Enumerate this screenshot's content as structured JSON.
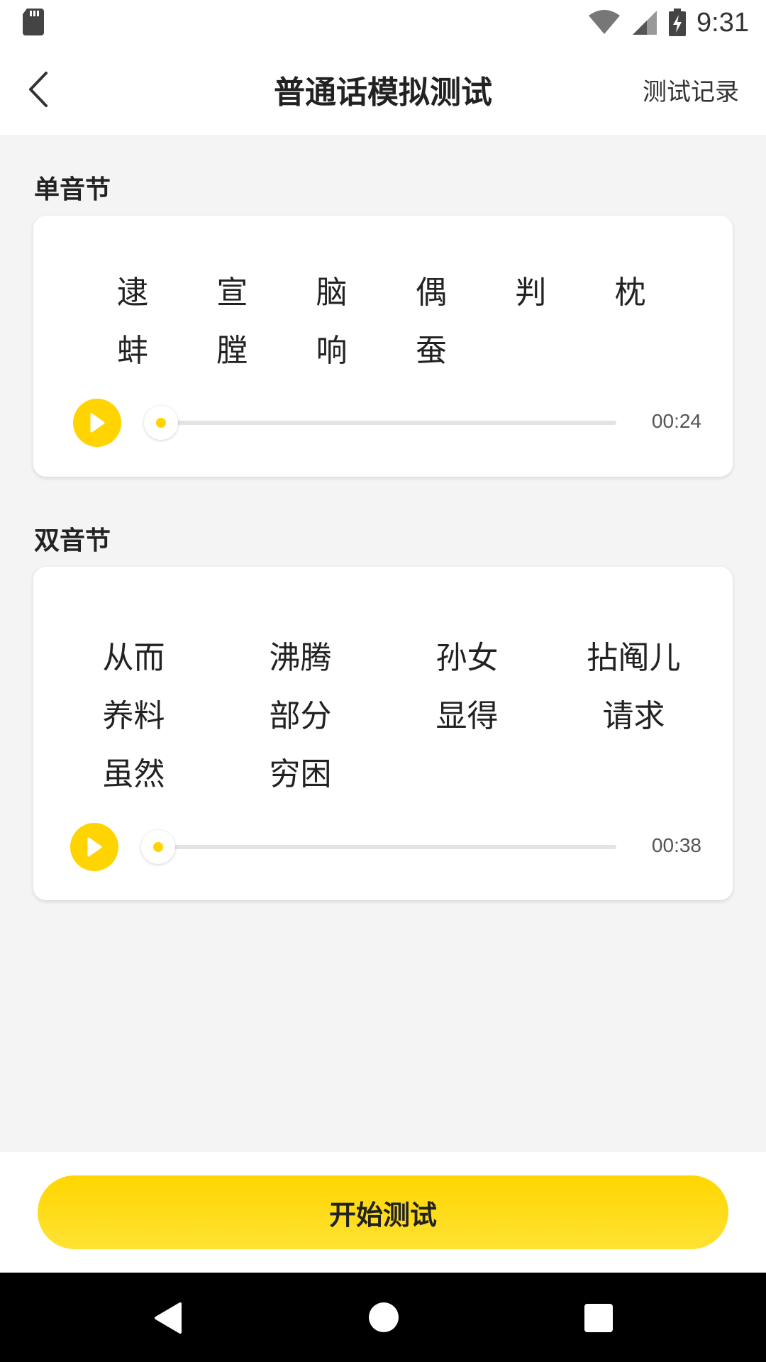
{
  "status_bar": {
    "time": "9:31",
    "icons": [
      "sd-card-icon",
      "wifi-icon",
      "signal-icon",
      "battery-charging-icon"
    ]
  },
  "header": {
    "back_icon": "chevron-left-icon",
    "title": "普通话模拟测试",
    "history_label": "测试记录"
  },
  "single_syllable": {
    "title": "单音节",
    "chars": [
      "逮",
      "宣",
      "脑",
      "偶",
      "判",
      "枕",
      "蚌",
      "膛",
      "响",
      "蚕"
    ],
    "player": {
      "duration": "00:24",
      "progress": 0
    }
  },
  "double_syllable": {
    "title": "双音节",
    "words": [
      "从而",
      "沸腾",
      "孙女",
      "拈阄儿",
      "养料",
      "部分",
      "显得",
      "请求",
      "虽然",
      "穷困"
    ],
    "player": {
      "duration": "00:38",
      "progress": 0
    }
  },
  "start_button_label": "开始测试",
  "colors": {
    "accent": "#ffd400",
    "background": "#f4f4f4"
  }
}
